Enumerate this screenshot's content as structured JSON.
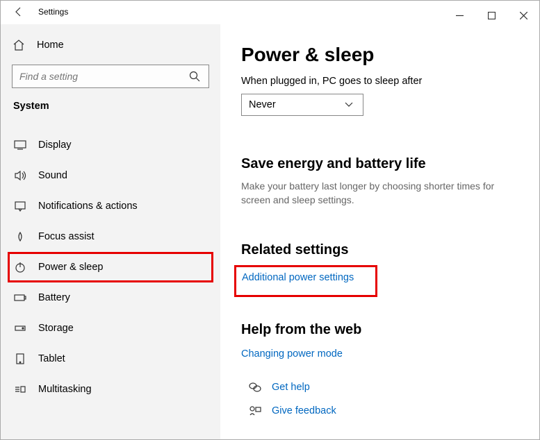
{
  "app_title": "Settings",
  "home_label": "Home",
  "search_placeholder": "Find a setting",
  "category": "System",
  "nav": [
    {
      "label": "Display"
    },
    {
      "label": "Sound"
    },
    {
      "label": "Notifications & actions"
    },
    {
      "label": "Focus assist"
    },
    {
      "label": "Power & sleep"
    },
    {
      "label": "Battery"
    },
    {
      "label": "Storage"
    },
    {
      "label": "Tablet"
    },
    {
      "label": "Multitasking"
    }
  ],
  "page": {
    "title": "Power & sleep",
    "sleep_label": "When plugged in, PC goes to sleep after",
    "sleep_value": "Never",
    "save_h": "Save energy and battery life",
    "save_p": "Make your battery last longer by choosing shorter times for screen and sleep settings.",
    "related_h": "Related settings",
    "related_link": "Additional power settings",
    "help_h": "Help from the web",
    "help_link": "Changing power mode",
    "get_help": "Get help",
    "feedback": "Give feedback"
  }
}
